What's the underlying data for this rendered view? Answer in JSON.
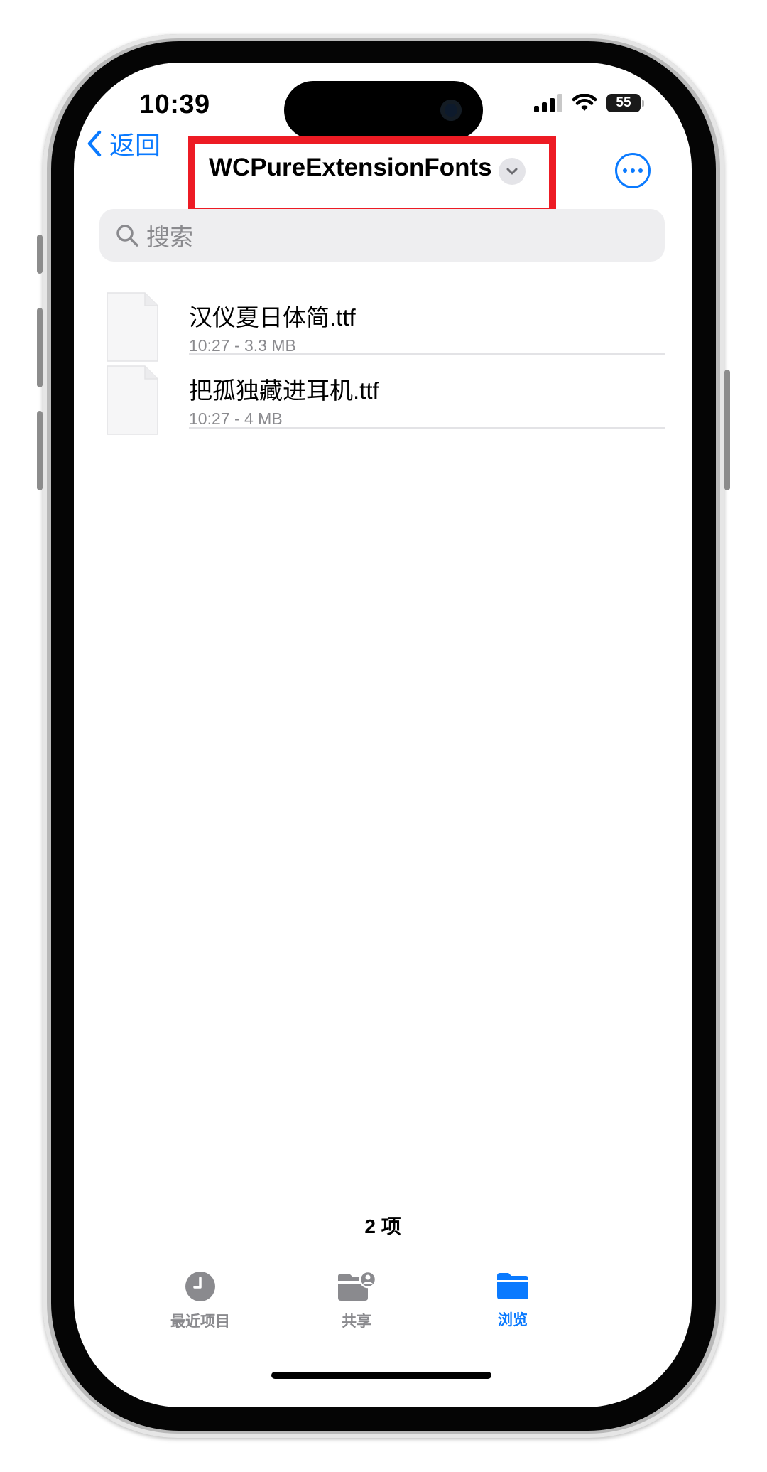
{
  "status_bar": {
    "time": "10:39",
    "battery": "55"
  },
  "nav": {
    "back_label": "返回",
    "title": "WCPureExtensionFonts"
  },
  "search": {
    "placeholder": "搜索"
  },
  "files": [
    {
      "name": "汉仪夏日体简.ttf",
      "meta": "10:27 - 3.3 MB"
    },
    {
      "name": "把孤独藏进耳机.ttf",
      "meta": "10:27 - 4 MB"
    }
  ],
  "item_count": "2 项",
  "tabbar": {
    "tabs": [
      {
        "label": "最近项目",
        "icon": "clock-icon",
        "active": false
      },
      {
        "label": "共享",
        "icon": "shared-folder-icon",
        "active": false
      },
      {
        "label": "浏览",
        "icon": "folder-icon",
        "active": true
      }
    ]
  },
  "colors": {
    "accent": "#0a7aff",
    "highlight_box": "#ed1b24",
    "inactive_tab": "#8a8a8e"
  }
}
